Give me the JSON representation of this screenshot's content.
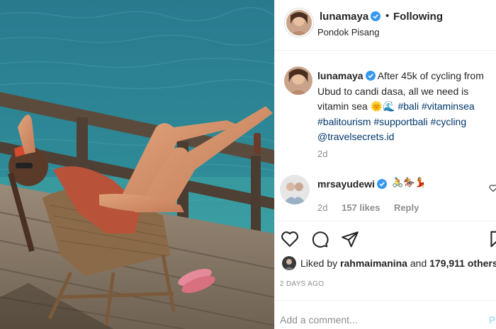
{
  "header": {
    "username": "lunamaya",
    "separator": "•",
    "follow_status": "Following",
    "location": "Pondok Pisang"
  },
  "caption": {
    "username": "lunamaya",
    "text": "After 45k of cycling from Ubud to candi dasa, all we need is vitamin sea",
    "emojis": "🌞🌊",
    "hashtags": [
      "#bali",
      "#vitaminsea",
      "#balitourism",
      "#supportbali",
      "#cycling"
    ],
    "mention": "@travelsecrets.id",
    "age": "2d"
  },
  "comment": {
    "username": "mrsayudewi",
    "emojis": "🚴🏇💃",
    "age": "2d",
    "likes": "157 likes",
    "reply": "Reply"
  },
  "likes": {
    "prefix": "Liked by",
    "user": "rahmaimanina",
    "middle": "and",
    "count": "179,911",
    "suffix": "others"
  },
  "timestamp": "2 DAYS AGO",
  "add_comment": {
    "placeholder": "Add a comment...",
    "post_label": "Post"
  },
  "icons": {
    "verified": "verified-badge-icon",
    "like": "heart-icon",
    "comment": "comment-bubble-icon",
    "share": "paper-plane-icon",
    "save": "bookmark-icon"
  },
  "colors": {
    "verified": "#3897f0",
    "link": "#00376b",
    "muted": "#8e8e8e",
    "post_disabled": "#b2dffc"
  }
}
